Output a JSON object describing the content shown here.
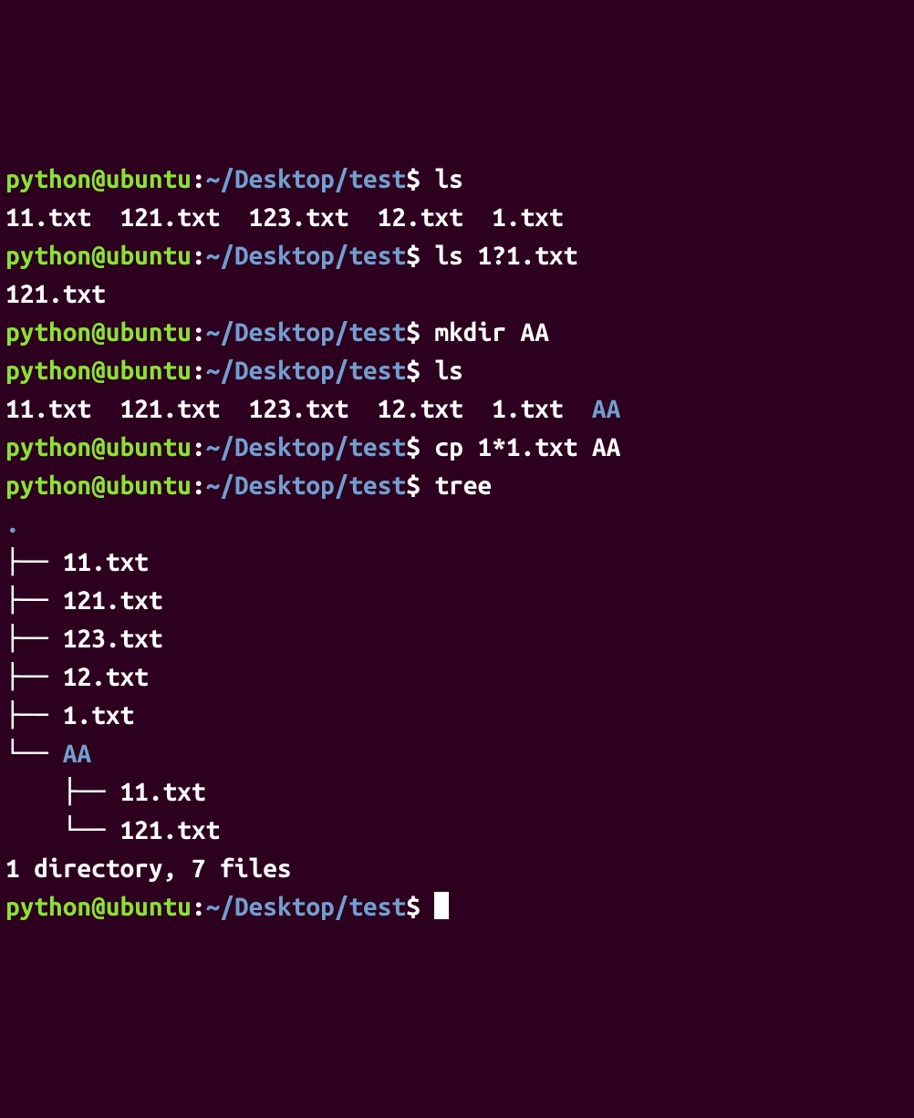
{
  "prompt": {
    "user": "python",
    "at": "@",
    "host": "ubuntu",
    "colon": ":",
    "path": "~/Desktop/test",
    "dollar": "$"
  },
  "commands": {
    "c1": "ls",
    "c2": "ls 1?1.txt",
    "c3": "mkdir AA",
    "c4": "ls",
    "c5": "cp 1*1.txt AA",
    "c6": "tree"
  },
  "outputs": {
    "ls1": "11.txt  121.txt  123.txt  12.txt  1.txt",
    "ls2": "121.txt",
    "ls3_files": "11.txt  121.txt  123.txt  12.txt  1.txt  ",
    "ls3_dir": "AA",
    "tree_dot": ".",
    "tree_l1": "├── 11.txt",
    "tree_l2": "├── 121.txt",
    "tree_l3": "├── 123.txt",
    "tree_l4": "├── 12.txt",
    "tree_l5": "├── 1.txt",
    "tree_l6_prefix": "└── ",
    "tree_l6_dir": "AA",
    "tree_l7": "    ├── 11.txt",
    "tree_l8": "    └── 121.txt",
    "tree_blank": "",
    "tree_summary": "1 directory, 7 files"
  }
}
